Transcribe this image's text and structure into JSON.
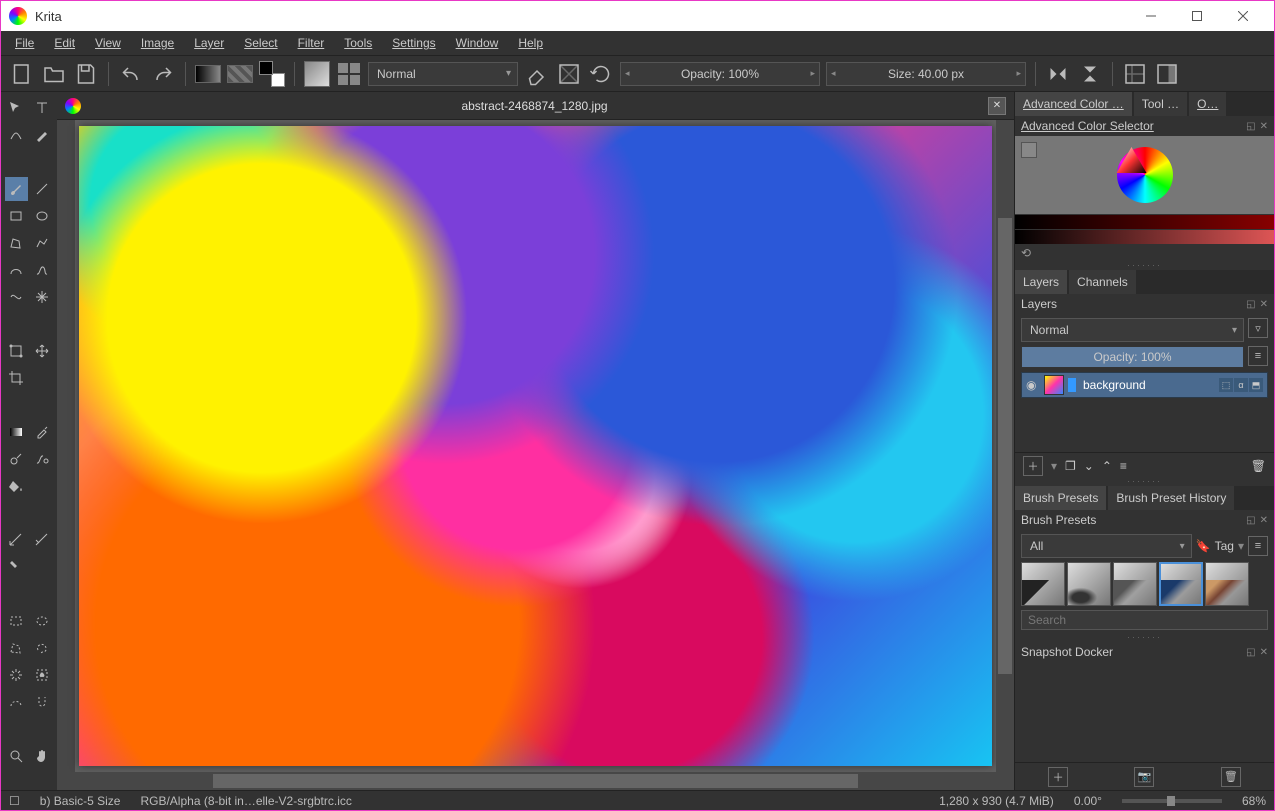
{
  "app": {
    "title": "Krita"
  },
  "menu": [
    "File",
    "Edit",
    "View",
    "Image",
    "Layer",
    "Select",
    "Filter",
    "Tools",
    "Settings",
    "Window",
    "Help"
  ],
  "toolbar": {
    "blend_mode": "Normal",
    "opacity": "Opacity: 100%",
    "size": "Size: 40.00 px"
  },
  "document": {
    "tab_title": "abstract-2468874_1280.jpg"
  },
  "panels": {
    "top_tabs": [
      "Advanced Color …",
      "Tool …",
      "O…"
    ],
    "acs_title": "Advanced Color Selector",
    "lc_tabs": [
      "Layers",
      "Channels"
    ],
    "layers": {
      "title": "Layers",
      "blend": "Normal",
      "opacity": "Opacity:  100%",
      "items": [
        {
          "name": "background"
        }
      ]
    },
    "bp_tabs": [
      "Brush Presets",
      "Brush Preset History"
    ],
    "brush_presets": {
      "title": "Brush Presets",
      "filter": "All",
      "tag": "Tag",
      "search_placeholder": "Search"
    },
    "snapshot_title": "Snapshot Docker"
  },
  "status": {
    "brush": "b) Basic-5 Size",
    "profile": "RGB/Alpha (8-bit in…elle-V2-srgbtrc.icc",
    "dims": "1,280 x 930 (4.7 MiB)",
    "angle": "0.00°",
    "zoom": "68%"
  }
}
